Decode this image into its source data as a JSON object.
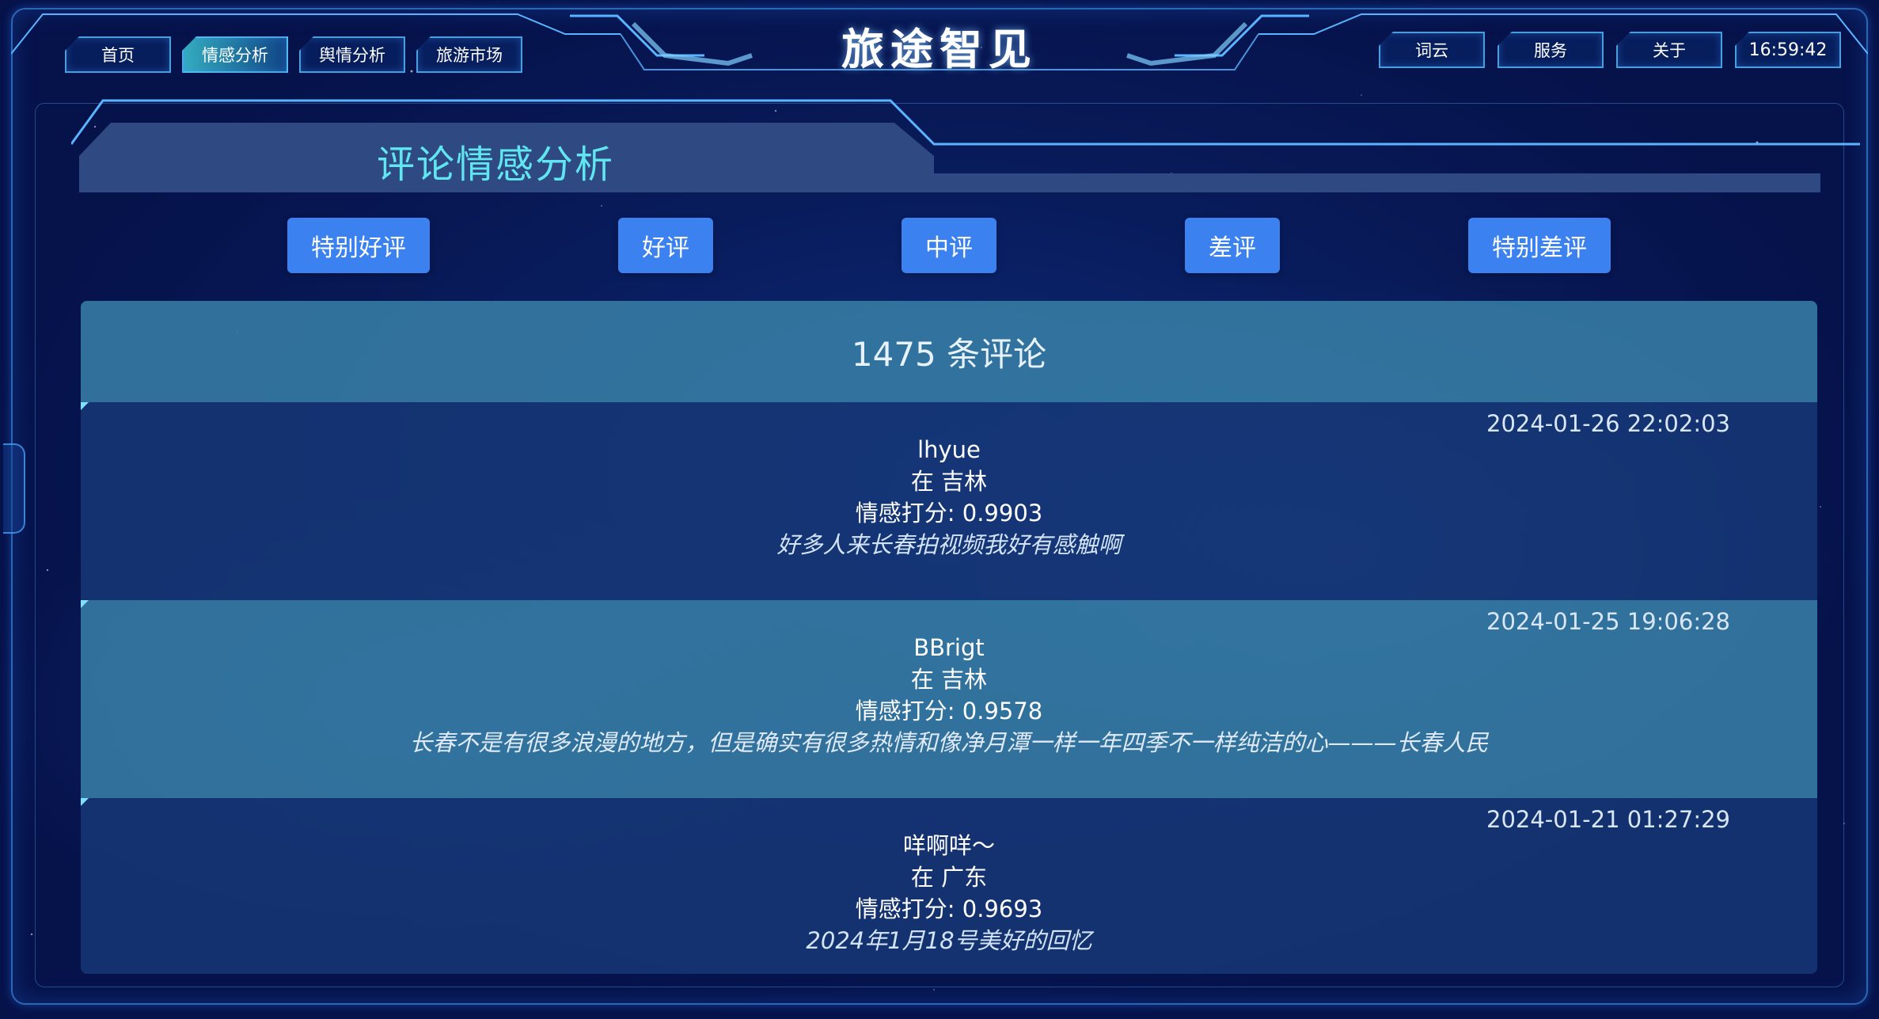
{
  "app": {
    "title": "旅途智见"
  },
  "nav_left": [
    {
      "label": "首页",
      "active": false
    },
    {
      "label": "情感分析",
      "active": true
    },
    {
      "label": "舆情分析",
      "active": false
    },
    {
      "label": "旅游市场",
      "active": false
    }
  ],
  "nav_right": [
    {
      "label": "词云"
    },
    {
      "label": "服务"
    },
    {
      "label": "关于"
    }
  ],
  "clock": "16:59:42",
  "panel": {
    "title": "评论情感分析"
  },
  "filters": [
    {
      "label": "特别好评"
    },
    {
      "label": "好评"
    },
    {
      "label": "中评"
    },
    {
      "label": "差评"
    },
    {
      "label": "特别差评"
    }
  ],
  "comments_count": "1475 条评论",
  "comments": [
    {
      "time": "2024-01-26 22:02:03",
      "user": "lhyue",
      "location": "在 吉林",
      "score": "情感打分: 0.9903",
      "text": "好多人来长春拍视频我好有感触啊"
    },
    {
      "time": "2024-01-25 19:06:28",
      "user": "BBrigt",
      "location": "在 吉林",
      "score": "情感打分: 0.9578",
      "text": "长春不是有很多浪漫的地方，但是确实有很多热情和像净月潭一样一年四季不一样纯洁的心———长春人民"
    },
    {
      "time": "2024-01-21 01:27:29",
      "user": "咩啊咩～",
      "location": "在 广东",
      "score": "情感打分: 0.9693",
      "text": "2024年1月18号美好的回忆"
    }
  ],
  "colors": {
    "accent_button": "#3b82f0",
    "panel_title": "#5fe6f0",
    "row_dark": "#16377a",
    "row_light": "#377da5",
    "frame": "#46a0ff"
  }
}
